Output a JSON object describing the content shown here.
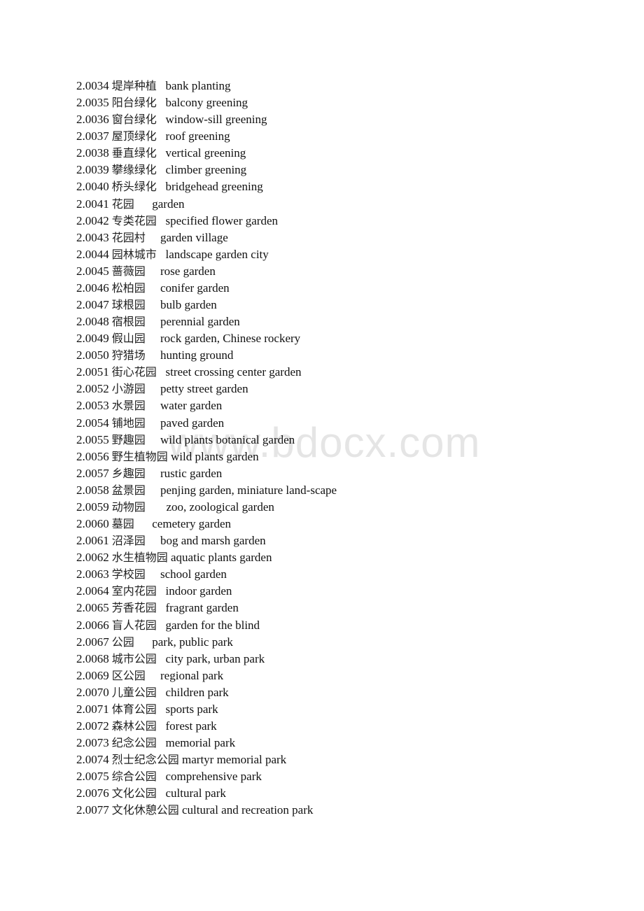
{
  "watermark": "www.bdocx.com",
  "entries": [
    {
      "num": "2.0034",
      "zh": "堤岸种植",
      "en": "bank planting",
      "gap": "   "
    },
    {
      "num": "2.0035",
      "zh": "阳台绿化",
      "en": "balcony greening",
      "gap": "   "
    },
    {
      "num": "2.0036",
      "zh": "窗台绿化",
      "en": "window-sill greening",
      "gap": "   "
    },
    {
      "num": "2.0037",
      "zh": "屋顶绿化",
      "en": "roof greening",
      "gap": "   "
    },
    {
      "num": "2.0038",
      "zh": "垂直绿化",
      "en": "vertical greening",
      "gap": "   "
    },
    {
      "num": "2.0039",
      "zh": "攀缘绿化",
      "en": "climber greening",
      "gap": "   "
    },
    {
      "num": "2.0040",
      "zh": "桥头绿化",
      "en": "bridgehead greening",
      "gap": "   "
    },
    {
      "num": "2.0041",
      "zh": "花园",
      "en": "garden",
      "gap": "      "
    },
    {
      "num": "2.0042",
      "zh": "专类花园",
      "en": "specified flower garden",
      "gap": "   "
    },
    {
      "num": "2.0043",
      "zh": "花园村",
      "en": "garden village",
      "gap": "     "
    },
    {
      "num": "2.0044",
      "zh": "园林城市",
      "en": "landscape garden city",
      "gap": "   "
    },
    {
      "num": "2.0045",
      "zh": "蔷薇园",
      "en": "rose garden",
      "gap": "     "
    },
    {
      "num": "2.0046",
      "zh": "松柏园",
      "en": "conifer garden",
      "gap": "     "
    },
    {
      "num": "2.0047",
      "zh": "球根园",
      "en": "bulb garden",
      "gap": "     "
    },
    {
      "num": "2.0048",
      "zh": "宿根园",
      "en": "perennial garden",
      "gap": "     "
    },
    {
      "num": "2.0049",
      "zh": "假山园",
      "en": "rock garden, Chinese rockery",
      "gap": "     "
    },
    {
      "num": "2.0050",
      "zh": "狩猎场",
      "en": "hunting ground",
      "gap": "     "
    },
    {
      "num": "2.0051",
      "zh": "街心花园",
      "en": "street crossing center garden",
      "gap": "   "
    },
    {
      "num": "2.0052",
      "zh": "小游园",
      "en": "petty street garden",
      "gap": "     "
    },
    {
      "num": "2.0053",
      "zh": "水景园",
      "en": "water garden",
      "gap": "     "
    },
    {
      "num": "2.0054",
      "zh": "铺地园",
      "en": "paved garden",
      "gap": "     "
    },
    {
      "num": "2.0055",
      "zh": "野趣园",
      "en": "wild plants botanical garden",
      "gap": "     "
    },
    {
      "num": "2.0056",
      "zh": "野生植物园",
      "en": "wild plants garden",
      "gap": " "
    },
    {
      "num": "2.0057",
      "zh": "乡趣园",
      "en": "rustic garden",
      "gap": "     "
    },
    {
      "num": "2.0058",
      "zh": "盆景园",
      "en": "penjing garden, miniature land-scape",
      "gap": "     "
    },
    {
      "num": "2.0059",
      "zh": "动物园",
      "en": "zoo, zoological garden",
      "gap": "       "
    },
    {
      "num": "2.0060",
      "zh": "墓园",
      "en": "cemetery garden",
      "gap": "      "
    },
    {
      "num": "2.0061",
      "zh": "沼泽园",
      "en": "bog and marsh garden",
      "gap": "     "
    },
    {
      "num": "2.0062",
      "zh": "水生植物园",
      "en": "aquatic plants garden",
      "gap": " "
    },
    {
      "num": "2.0063",
      "zh": "学校园",
      "en": "school garden",
      "gap": "     "
    },
    {
      "num": "2.0064",
      "zh": "室内花园",
      "en": "indoor garden",
      "gap": "   "
    },
    {
      "num": "2.0065",
      "zh": "芳香花园",
      "en": "fragrant garden",
      "gap": "   "
    },
    {
      "num": "2.0066",
      "zh": "盲人花园",
      "en": "garden for the blind",
      "gap": "   "
    },
    {
      "num": "2.0067",
      "zh": "公园",
      "en": "park, public park",
      "gap": "      "
    },
    {
      "num": "2.0068",
      "zh": "城市公园",
      "en": "city park, urban park",
      "gap": "   "
    },
    {
      "num": "2.0069",
      "zh": "区公园",
      "en": "regional park",
      "gap": "     "
    },
    {
      "num": "2.0070",
      "zh": "儿童公园",
      "en": "children park",
      "gap": "   "
    },
    {
      "num": "2.0071",
      "zh": "体育公园",
      "en": "sports park",
      "gap": "   "
    },
    {
      "num": "2.0072",
      "zh": "森林公园",
      "en": "forest park",
      "gap": "   "
    },
    {
      "num": "2.0073",
      "zh": "纪念公园",
      "en": "memorial park",
      "gap": "   "
    },
    {
      "num": "2.0074",
      "zh": "烈士纪念公园",
      "en": "martyr memorial park",
      "gap": " "
    },
    {
      "num": "2.0075",
      "zh": "综合公园",
      "en": "comprehensive park",
      "gap": "   "
    },
    {
      "num": "2.0076",
      "zh": "文化公园",
      "en": "cultural park",
      "gap": "   "
    },
    {
      "num": "2.0077",
      "zh": "文化休憩公园",
      "en": "cultural and recreation park",
      "gap": " "
    }
  ]
}
